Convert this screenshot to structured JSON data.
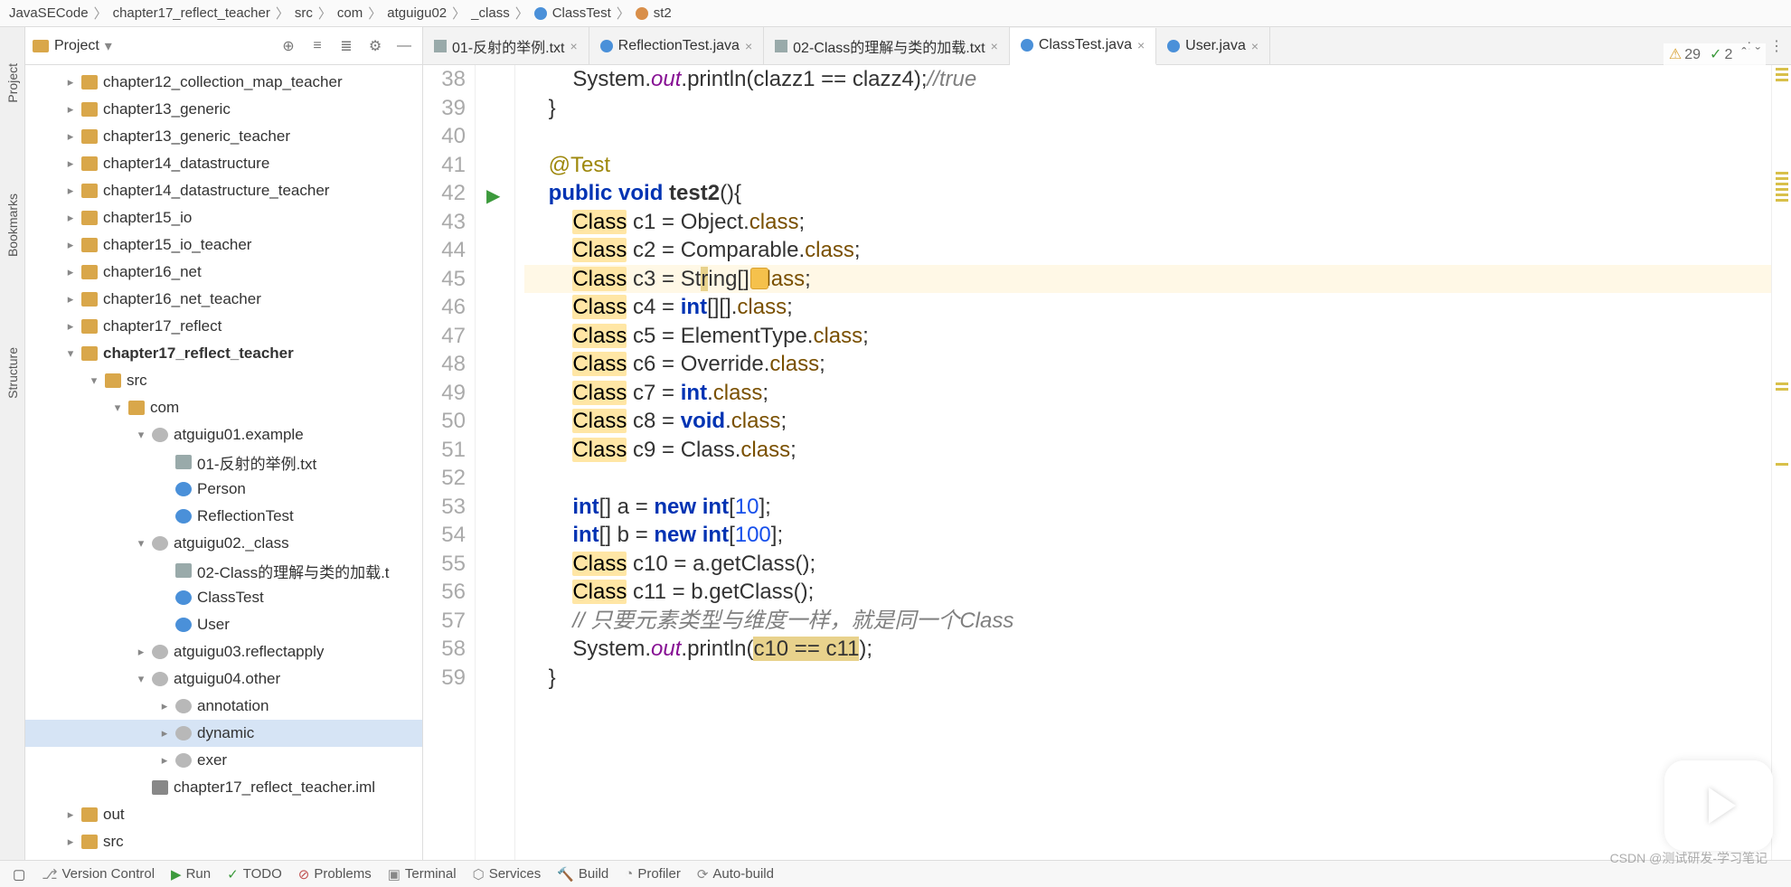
{
  "breadcrumb": [
    "JavaSECode",
    "chapter17_reflect_teacher",
    "src",
    "com",
    "atguigu02",
    "_class",
    "ClassTest",
    "st2"
  ],
  "project": {
    "title": "Project",
    "tree": [
      {
        "indent": 1,
        "arrow": "collapsed",
        "icon": "folder",
        "label": "chapter12_collection_map_teacher"
      },
      {
        "indent": 1,
        "arrow": "collapsed",
        "icon": "folder",
        "label": "chapter13_generic"
      },
      {
        "indent": 1,
        "arrow": "collapsed",
        "icon": "folder",
        "label": "chapter13_generic_teacher"
      },
      {
        "indent": 1,
        "arrow": "collapsed",
        "icon": "folder",
        "label": "chapter14_datastructure"
      },
      {
        "indent": 1,
        "arrow": "collapsed",
        "icon": "folder",
        "label": "chapter14_datastructure_teacher"
      },
      {
        "indent": 1,
        "arrow": "collapsed",
        "icon": "folder",
        "label": "chapter15_io"
      },
      {
        "indent": 1,
        "arrow": "collapsed",
        "icon": "folder",
        "label": "chapter15_io_teacher"
      },
      {
        "indent": 1,
        "arrow": "collapsed",
        "icon": "folder",
        "label": "chapter16_net"
      },
      {
        "indent": 1,
        "arrow": "collapsed",
        "icon": "folder",
        "label": "chapter16_net_teacher"
      },
      {
        "indent": 1,
        "arrow": "collapsed",
        "icon": "folder",
        "label": "chapter17_reflect"
      },
      {
        "indent": 1,
        "arrow": "expanded",
        "icon": "folder",
        "label": "chapter17_reflect_teacher",
        "bold": true
      },
      {
        "indent": 2,
        "arrow": "expanded",
        "icon": "folder",
        "label": "src"
      },
      {
        "indent": 3,
        "arrow": "expanded",
        "icon": "folder",
        "label": "com"
      },
      {
        "indent": 4,
        "arrow": "expanded",
        "icon": "pkg",
        "label": "atguigu01.example"
      },
      {
        "indent": 5,
        "arrow": "",
        "icon": "txt",
        "label": "01-反射的举例.txt"
      },
      {
        "indent": 5,
        "arrow": "",
        "icon": "cls",
        "label": "Person"
      },
      {
        "indent": 5,
        "arrow": "",
        "icon": "cls",
        "label": "ReflectionTest"
      },
      {
        "indent": 4,
        "arrow": "expanded",
        "icon": "pkg",
        "label": "atguigu02._class"
      },
      {
        "indent": 5,
        "arrow": "",
        "icon": "txt",
        "label": "02-Class的理解与类的加载.t"
      },
      {
        "indent": 5,
        "arrow": "",
        "icon": "cls",
        "label": "ClassTest"
      },
      {
        "indent": 5,
        "arrow": "",
        "icon": "cls",
        "label": "User"
      },
      {
        "indent": 4,
        "arrow": "collapsed",
        "icon": "pkg",
        "label": "atguigu03.reflectapply"
      },
      {
        "indent": 4,
        "arrow": "expanded",
        "icon": "pkg",
        "label": "atguigu04.other"
      },
      {
        "indent": 5,
        "arrow": "collapsed",
        "icon": "pkg",
        "label": "annotation"
      },
      {
        "indent": 5,
        "arrow": "collapsed",
        "icon": "pkg",
        "label": "dynamic",
        "sel": true
      },
      {
        "indent": 5,
        "arrow": "collapsed",
        "icon": "pkg",
        "label": "exer"
      },
      {
        "indent": 4,
        "arrow": "",
        "icon": "iml",
        "label": "chapter17_reflect_teacher.iml"
      },
      {
        "indent": 1,
        "arrow": "collapsed",
        "icon": "folder",
        "label": "out"
      },
      {
        "indent": 1,
        "arrow": "collapsed",
        "icon": "folder",
        "label": "src"
      }
    ]
  },
  "tabs": [
    {
      "icon": "txt",
      "label": "01-反射的举例.txt"
    },
    {
      "icon": "java",
      "label": "ReflectionTest.java"
    },
    {
      "icon": "txt",
      "label": "02-Class的理解与类的加载.txt"
    },
    {
      "icon": "java",
      "label": "ClassTest.java",
      "active": true
    },
    {
      "icon": "java",
      "label": "User.java"
    }
  ],
  "code": {
    "start": 38,
    "runLine": 42,
    "curLine": 45,
    "lines": [
      "        System.<fld>out</fld>.println(clazz1 == clazz4);<cmt>//true</cmt>",
      "    }",
      "",
      "    <ann>@Test</ann>",
      "    <kw>public</kw> <kw>void</kw> <b>test2</b>(){",
      "        <cls-ref>Class</cls-ref> c1 = Object.<cls-name>class</cls-name>;",
      "        <cls-ref>Class</cls-ref> c2 = Comparable.<cls-name>class</cls-name>;",
      "        <cls-ref>Class</cls-ref> c3 = St<hl>r</hl>ing[].<cls-name>class</cls-name>;",
      "        <cls-ref>Class</cls-ref> c4 = <kw>int</kw>[][].<cls-name>class</cls-name>;",
      "        <cls-ref>Class</cls-ref> c5 = ElementType.<cls-name>class</cls-name>;",
      "        <cls-ref>Class</cls-ref> c6 = Override.<cls-name>class</cls-name>;",
      "        <cls-ref>Class</cls-ref> c7 = <kw>int</kw>.<cls-name>class</cls-name>;",
      "        <cls-ref>Class</cls-ref> c8 = <kw>void</kw>.<cls-name>class</cls-name>;",
      "        <cls-ref>Class</cls-ref> c9 = Class.<cls-name>class</cls-name>;",
      "",
      "        <kw>int</kw>[] a = <kw>new</kw> <kw>int</kw>[<num>10</num>];",
      "        <kw>int</kw>[] b = <kw>new</kw> <kw>int</kw>[<num>100</num>];",
      "        <cls-ref>Class</cls-ref> c10 = a.getClass();",
      "        <cls-ref>Class</cls-ref> c11 = b.getClass();",
      "        <cmt2>// 只要元素类型与维度一样，就是同一个Class</cmt2>",
      "        System.<fld>out</fld>.println(<hl>c10 == c11</hl>);",
      "    }"
    ]
  },
  "status": {
    "warnings": "29",
    "checks": "2",
    "up": "ˆ",
    "down": "ˇ"
  },
  "bottom": {
    "vc": "Version Control",
    "run": "Run",
    "todo": "TODO",
    "problems": "Problems",
    "terminal": "Terminal",
    "services": "Services",
    "build": "Build",
    "profiler": "Profiler",
    "auto": "Auto-build"
  },
  "leftStrip": {
    "project": "Project",
    "bookmarks": "Bookmarks",
    "structure": "Structure"
  },
  "watermark": "CSDN @测试研发-学习笔记"
}
